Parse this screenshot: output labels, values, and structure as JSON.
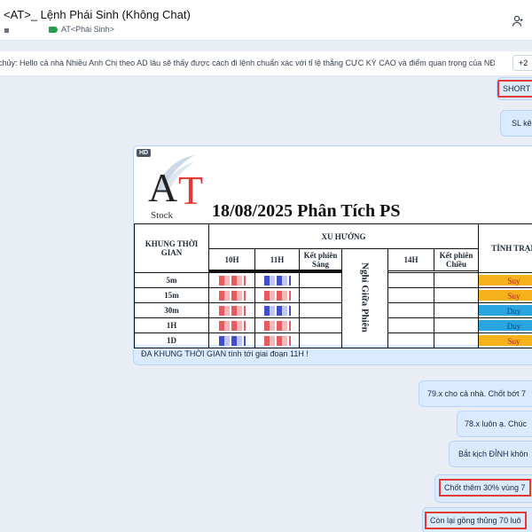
{
  "header": {
    "title": "<AT>_ Lệnh Phái Sinh (Không Chat)",
    "tag": "AT<Phái Sinh>"
  },
  "pinned": {
    "text": "chủy: Hello cả nhà Nhiều Anh Chị theo AD lâu sẽ thấy được cách đi lệnh chuẩn xác với tỉ lệ thắng CỰC KỲ CAO và điểm quan trọng của NĐT là cần phải ...",
    "more": "+2"
  },
  "messages": {
    "short": "SHORT",
    "sl": "SL kê",
    "m79": "79.x cho cả nhà. Chốt bớt 7",
    "m78": "78.x luôn ạ. Chúc",
    "bat": "Bắt kịch ĐỈNH khôn",
    "chot": "Chốt thêm 30% vùng 7",
    "con": "Còn lại gồng thủng 70 luô"
  },
  "image": {
    "badge": "HD",
    "logo_a": "A",
    "logo_t": "T",
    "logo_stock": "Stock",
    "title": "18/08/2025 Phân Tích PS",
    "caption": "ĐA KHUNG THỜI GIAN tính tới giai đoạn 11H !",
    "table": {
      "col_khung": "KHUNG THỜI GIAN",
      "col_xu_huong": "XU HƯỚNG",
      "col_10h": "10H",
      "col_11h": "11H",
      "col_ket_sang": "Kết phiên Sáng",
      "col_nghi": "Nghỉ Giữa Phiên",
      "col_14h": "14H",
      "col_ket_chieu": "Kết phiên Chiều",
      "col_tinh_trang": "TÌNH TRẠN",
      "rows": [
        {
          "tf": "5m",
          "status": "Suy",
          "kind": "sell"
        },
        {
          "tf": "15m",
          "status": "Suy",
          "kind": "sell"
        },
        {
          "tf": "30m",
          "status": "Duy",
          "kind": "hold"
        },
        {
          "tf": "1H",
          "status": "Duy",
          "kind": "hold"
        },
        {
          "tf": "1D",
          "status": "Suy",
          "kind": "sell"
        }
      ]
    }
  }
}
